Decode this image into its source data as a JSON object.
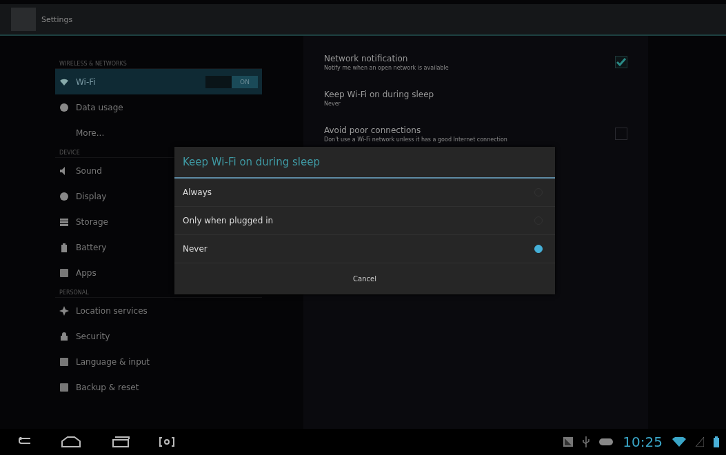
{
  "action_bar": {
    "title": "Settings"
  },
  "sidebar": {
    "sections": [
      {
        "header": "WIRELESS & NETWORKS",
        "items": [
          {
            "label": "Wi-Fi",
            "selected": true,
            "toggle": {
              "label": "ON",
              "on": true
            }
          },
          {
            "label": "Data usage",
            "selected": false
          },
          {
            "label": "More...",
            "selected": false
          }
        ]
      },
      {
        "header": "DEVICE",
        "items": [
          {
            "label": "Sound",
            "selected": false
          },
          {
            "label": "Display",
            "selected": false
          },
          {
            "label": "Storage",
            "selected": false
          },
          {
            "label": "Battery",
            "selected": false
          },
          {
            "label": "Apps",
            "selected": false
          }
        ]
      },
      {
        "header": "PERSONAL",
        "items": [
          {
            "label": "Location services",
            "selected": false
          },
          {
            "label": "Security",
            "selected": false
          },
          {
            "label": "Language & input",
            "selected": false
          },
          {
            "label": "Backup & reset",
            "selected": false
          }
        ]
      }
    ]
  },
  "settings": [
    {
      "kind": "checkbox",
      "title": "Network notification",
      "summary": "Notify me when an open network is available",
      "checked": true
    },
    {
      "kind": "plain",
      "title": "Keep Wi-Fi on during sleep",
      "summary": "Never"
    },
    {
      "kind": "checkbox",
      "title": "Avoid poor connections",
      "summary": "Don't use a Wi-Fi network unless it has a good Internet connection",
      "checked": false
    }
  ],
  "dialog": {
    "title": "Keep Wi-Fi on during sleep",
    "options": [
      {
        "label": "Always",
        "selected": false
      },
      {
        "label": "Only when plugged in",
        "selected": false
      },
      {
        "label": "Never",
        "selected": true
      }
    ],
    "button": "Cancel"
  },
  "status_bar": {
    "time": "10:25"
  }
}
